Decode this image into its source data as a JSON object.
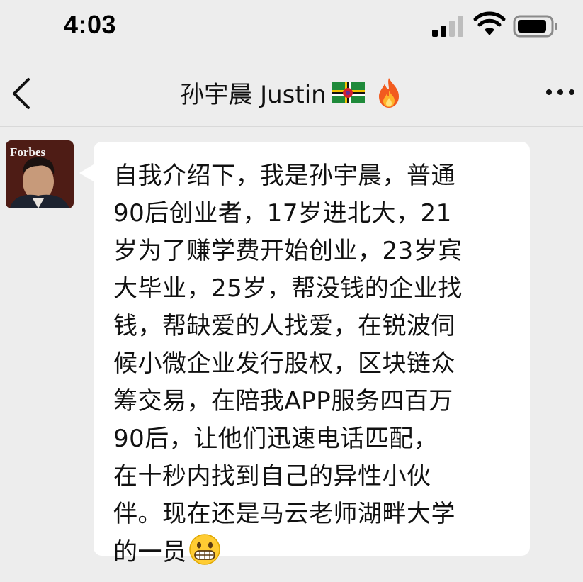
{
  "status_bar": {
    "time": "4:03",
    "icons": [
      "signal-icon",
      "wifi-icon",
      "battery-icon"
    ]
  },
  "nav_bar": {
    "back_icon": "chevron-left-icon",
    "title": "孙宇晨 Justin",
    "title_emojis": [
      "dominica-flag-icon",
      "fire-icon"
    ],
    "more_icon": "more-dots-icon"
  },
  "message": {
    "sender_avatar": "avatar",
    "avatar_text": "Forbes",
    "lines": [
      "自我介绍下，我是孙宇晨，普通",
      "90后创业者，17岁进北大，21",
      "岁为了赚学费开始创业，23岁宾",
      "大毕业，25岁，帮没钱的企业找",
      "钱，帮缺爱的人找爱，在锐波伺",
      "候小微企业发行股权，区块链众",
      "筹交易，在陪我APP服务四百万",
      "90后，让他们迅速电话匹配，",
      "在十秒内找到自己的异性小伙",
      "伴。现在还是马云老师湖畔大学",
      "的一员"
    ],
    "trailing_emoji": "grinning-face-icon"
  },
  "colors": {
    "background": "#ededed",
    "bubble": "#ffffff",
    "text": "#111111"
  }
}
